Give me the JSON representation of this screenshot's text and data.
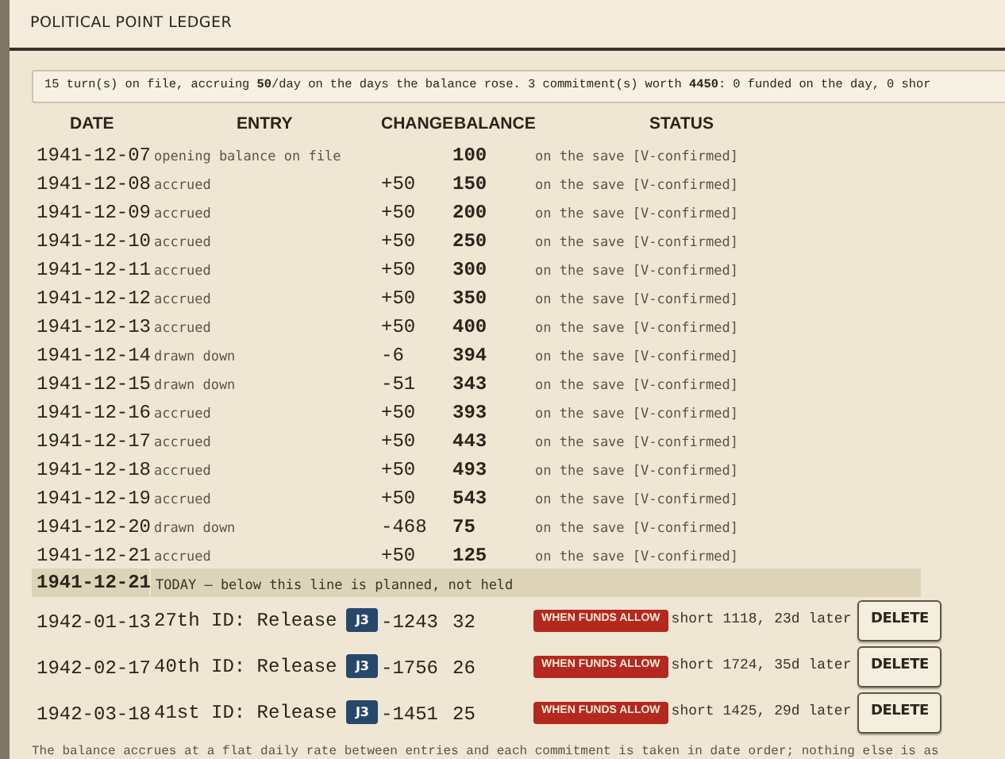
{
  "title": "POLITICAL POINT LEDGER",
  "summary": "15 turn(s) on file, accruing **50**/day on the days the balance rose. 3 commitment(s) worth **4450**: 0 funded on the day, 0 shor",
  "columns": [
    "DATE",
    "ENTRY",
    "CHANGE",
    "BALANCE",
    "STATUS"
  ],
  "rows": [
    {
      "kind": "entry",
      "date": "1941-12-07",
      "entry": "opening balance on file",
      "change": "",
      "balance": "100",
      "status": "on the save [V-confirmed]"
    },
    {
      "kind": "entry",
      "date": "1941-12-08",
      "entry": "accrued",
      "change": "+50",
      "balance": "150",
      "status": "on the save [V-confirmed]"
    },
    {
      "kind": "entry",
      "date": "1941-12-09",
      "entry": "accrued",
      "change": "+50",
      "balance": "200",
      "status": "on the save [V-confirmed]"
    },
    {
      "kind": "entry",
      "date": "1941-12-10",
      "entry": "accrued",
      "change": "+50",
      "balance": "250",
      "status": "on the save [V-confirmed]"
    },
    {
      "kind": "entry",
      "date": "1941-12-11",
      "entry": "accrued",
      "change": "+50",
      "balance": "300",
      "status": "on the save [V-confirmed]"
    },
    {
      "kind": "entry",
      "date": "1941-12-12",
      "entry": "accrued",
      "change": "+50",
      "balance": "350",
      "status": "on the save [V-confirmed]"
    },
    {
      "kind": "entry",
      "date": "1941-12-13",
      "entry": "accrued",
      "change": "+50",
      "balance": "400",
      "status": "on the save [V-confirmed]"
    },
    {
      "kind": "entry",
      "date": "1941-12-14",
      "entry": "drawn down",
      "change": "-6",
      "balance": "394",
      "status": "on the save [V-confirmed]"
    },
    {
      "kind": "entry",
      "date": "1941-12-15",
      "entry": "drawn down",
      "change": "-51",
      "balance": "343",
      "status": "on the save [V-confirmed]"
    },
    {
      "kind": "entry",
      "date": "1941-12-16",
      "entry": "accrued",
      "change": "+50",
      "balance": "393",
      "status": "on the save [V-confirmed]"
    },
    {
      "kind": "entry",
      "date": "1941-12-17",
      "entry": "accrued",
      "change": "+50",
      "balance": "443",
      "status": "on the save [V-confirmed]"
    },
    {
      "kind": "entry",
      "date": "1941-12-18",
      "entry": "accrued",
      "change": "+50",
      "balance": "493",
      "status": "on the save [V-confirmed]"
    },
    {
      "kind": "entry",
      "date": "1941-12-19",
      "entry": "accrued",
      "change": "+50",
      "balance": "543",
      "status": "on the save [V-confirmed]"
    },
    {
      "kind": "entry",
      "date": "1941-12-20",
      "entry": "drawn down",
      "change": "-468",
      "balance": "75",
      "status": "on the save [V-confirmed]"
    },
    {
      "kind": "entry",
      "date": "1941-12-21",
      "entry": "accrued",
      "change": "+50",
      "balance": "125",
      "status": "on the save [V-confirmed]"
    },
    {
      "kind": "today",
      "date": "1941-12-21",
      "entry": "TODAY — below this line is planned, not held"
    },
    {
      "kind": "commitment",
      "date": "1942-01-13",
      "entry": "27th ID: Release",
      "badge": "J3",
      "change": "-1243",
      "balance": "32",
      "tag": "WHEN FUNDS ALLOW",
      "note": "short 1118, 23d later",
      "button": "DELETE"
    },
    {
      "kind": "commitment",
      "date": "1942-02-17",
      "entry": "40th ID: Release",
      "badge": "J3",
      "change": "-1756",
      "balance": "26",
      "tag": "WHEN FUNDS ALLOW",
      "note": "short 1724, 35d later",
      "button": "DELETE"
    },
    {
      "kind": "commitment",
      "date": "1942-03-18",
      "entry": "41st ID: Release",
      "badge": "J3",
      "change": "-1451",
      "balance": "25",
      "tag": "WHEN FUNDS ALLOW",
      "note": "short 1425, 29d later",
      "button": "DELETE"
    }
  ],
  "footer": "The balance accrues at a flat daily rate between entries and each commitment is taken in date order; nothing else is as"
}
